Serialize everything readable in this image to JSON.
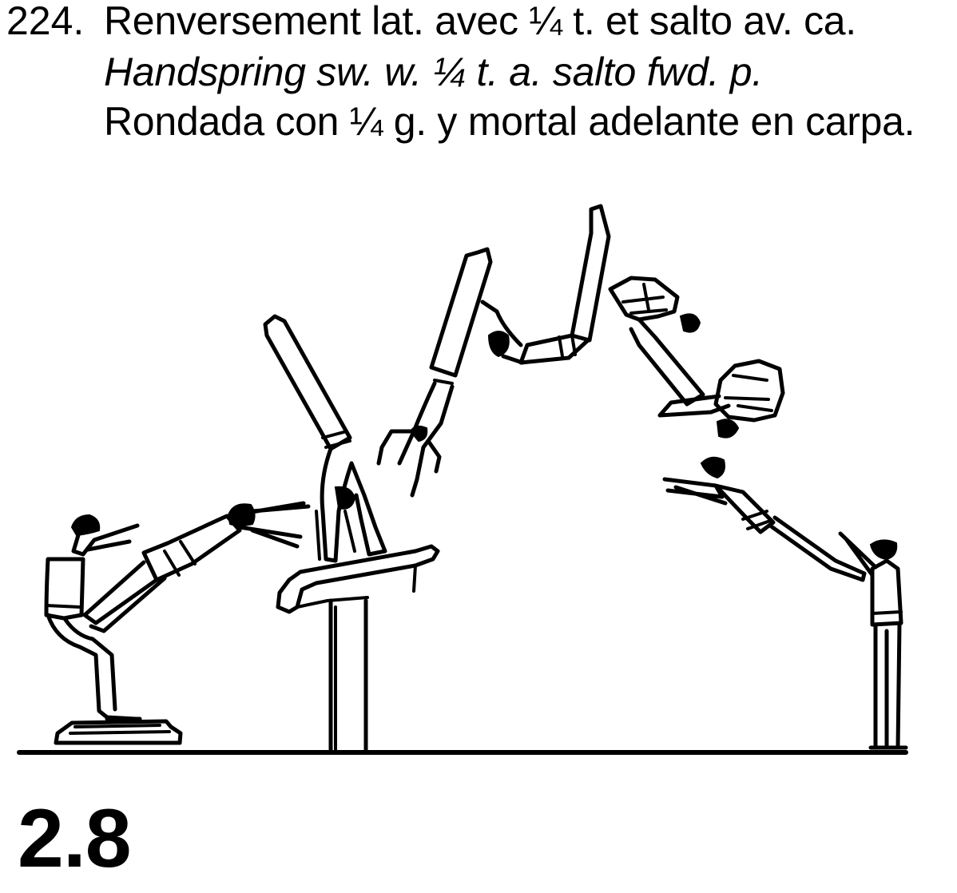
{
  "element": {
    "number": "224.",
    "name_fr": "Renversement lat. avec ¼ t. et salto av. ca.",
    "name_en": "Handspring sw. w. ¼ t. a. salto fwd. p.",
    "name_es": "Rondada con ¼ g. y mortal adelante en carpa."
  },
  "difficulty_value": "2.8",
  "colors": {
    "ink": "#000000",
    "paper": "#ffffff"
  }
}
